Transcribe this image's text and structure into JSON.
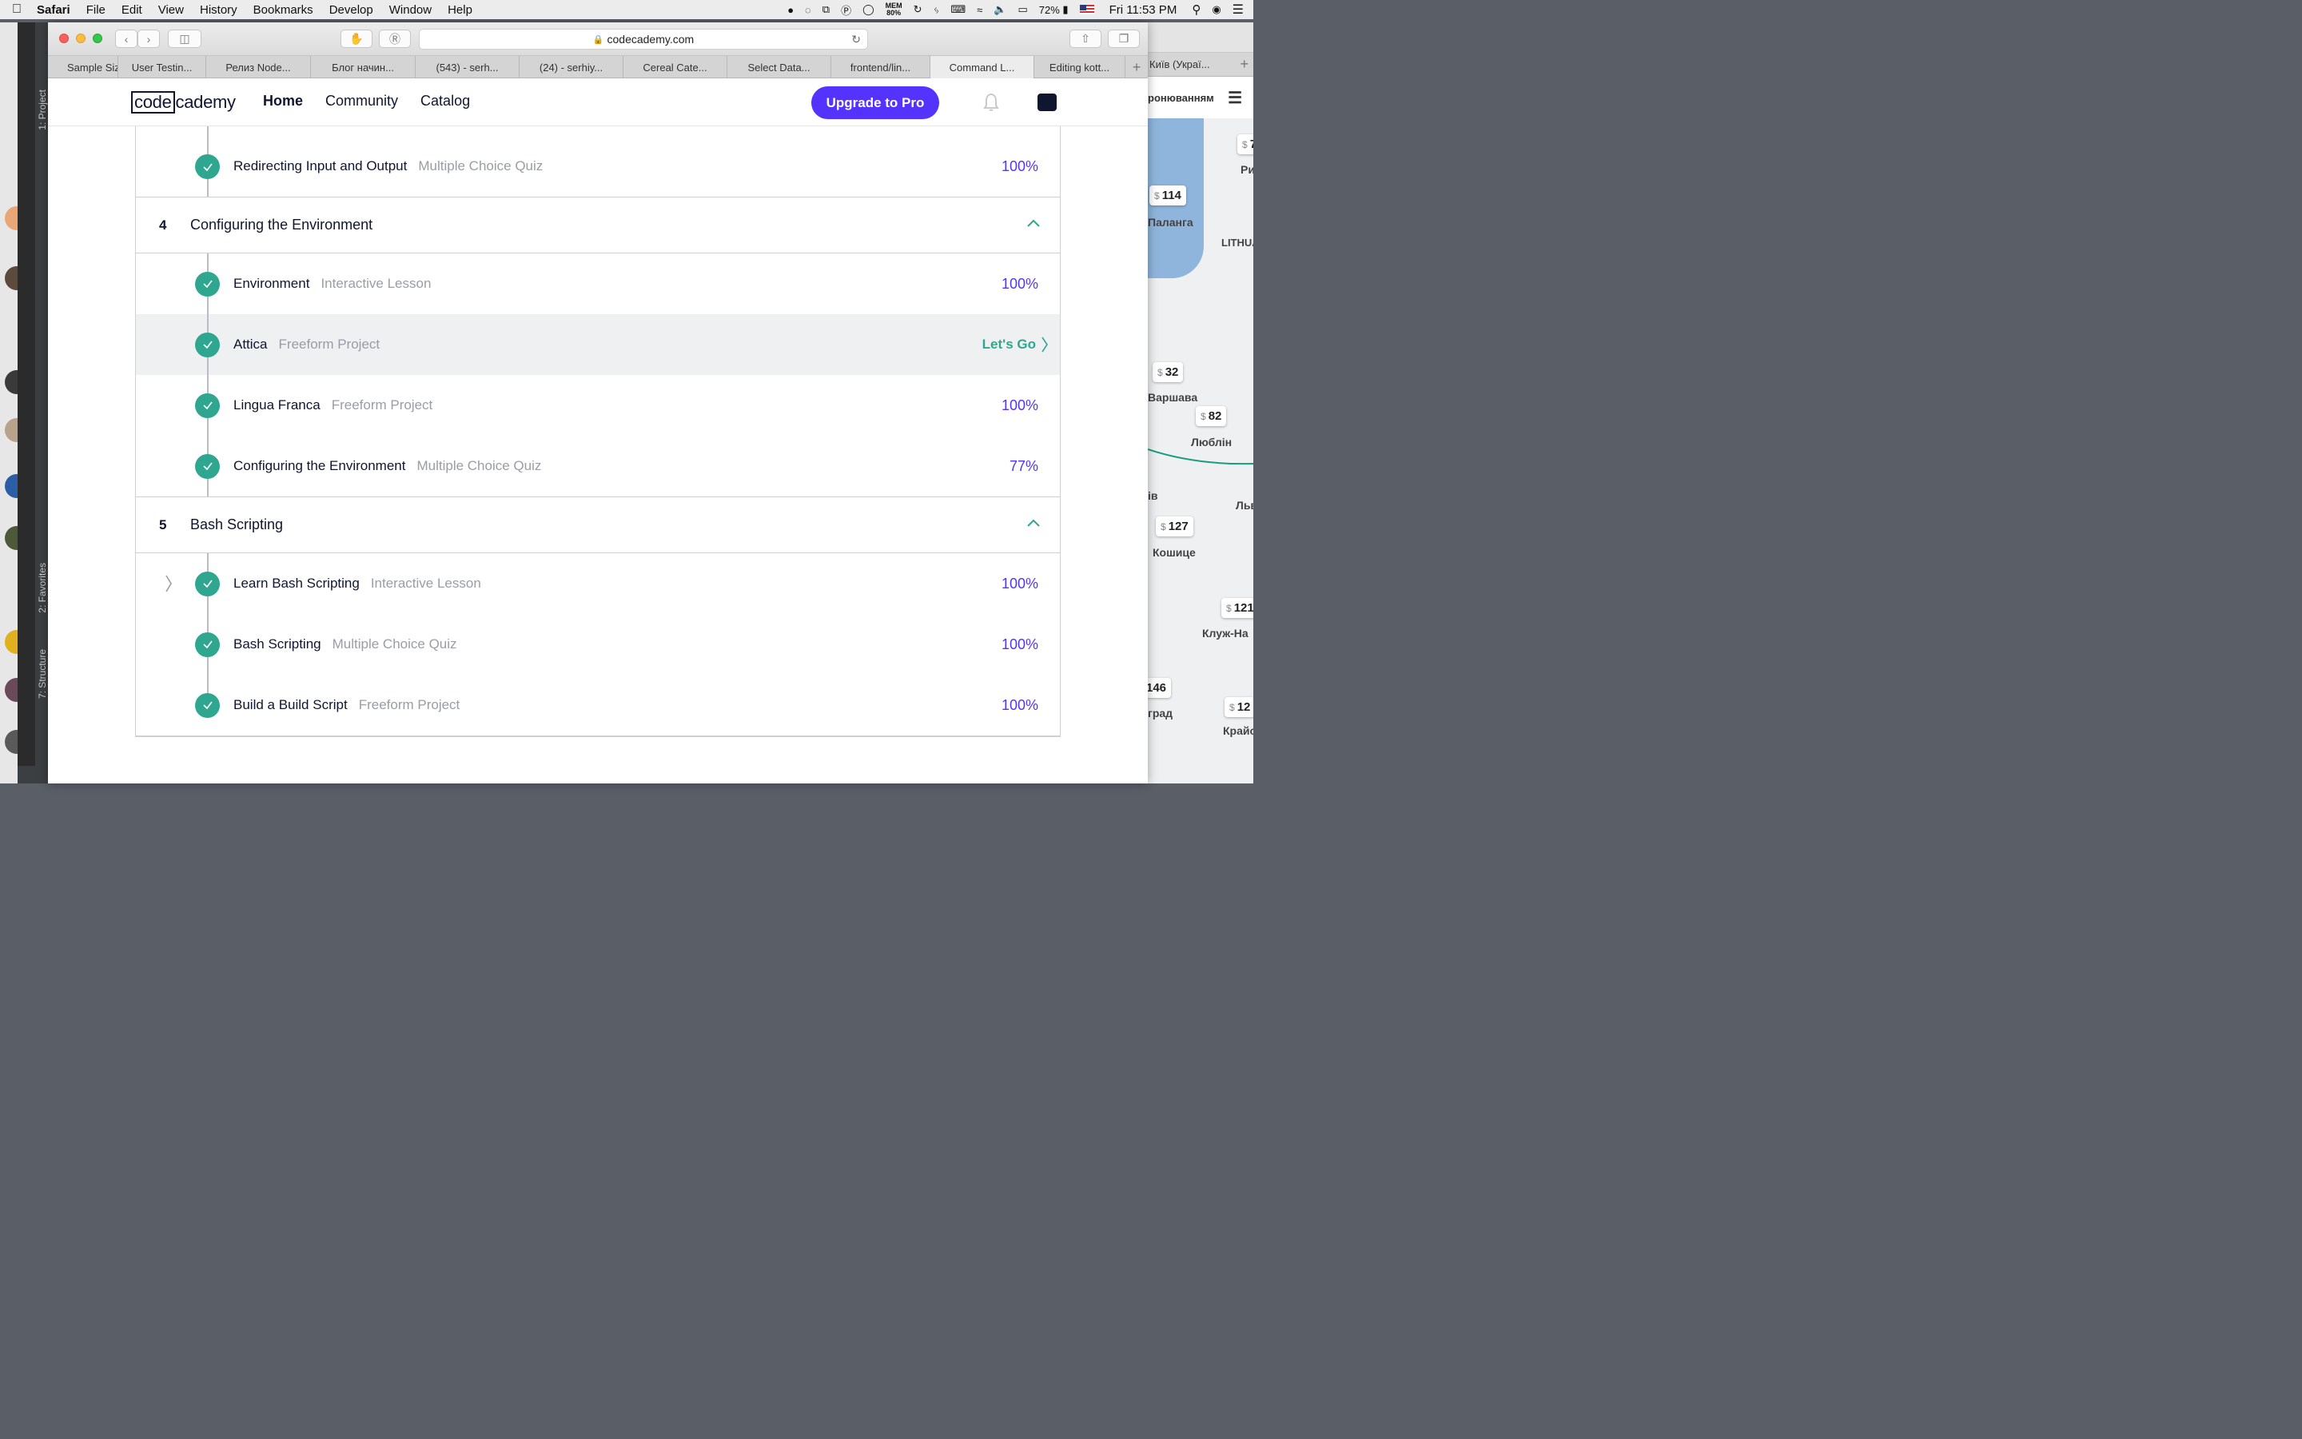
{
  "menubar": {
    "app": "Safari",
    "items": [
      "File",
      "Edit",
      "View",
      "History",
      "Bookmarks",
      "Develop",
      "Window",
      "Help"
    ],
    "mem_label": "MEM",
    "mem_value": "80%",
    "battery": "72%",
    "clock": "Fri 11:53 PM"
  },
  "browser": {
    "url": "codecademy.com",
    "tabs": [
      {
        "label": "Sample Size",
        "active": false
      },
      {
        "label": "User Testin...",
        "active": false
      },
      {
        "label": "Релиз Node...",
        "active": false
      },
      {
        "label": "Блог начин...",
        "active": false
      },
      {
        "label": "(543) - serh...",
        "active": false
      },
      {
        "label": "(24) - serhiy...",
        "active": false
      },
      {
        "label": "Cereal Cate...",
        "active": false
      },
      {
        "label": "Select Data...",
        "active": false
      },
      {
        "label": "frontend/lin...",
        "active": false
      },
      {
        "label": "Command L...",
        "active": true
      },
      {
        "label": "Editing kott...",
        "active": false
      }
    ],
    "new_tab": "+"
  },
  "codecademy": {
    "logo_boxed": "code",
    "logo_rest": "cademy",
    "nav": [
      "Home",
      "Community",
      "Catalog"
    ],
    "upgrade_button": "Upgrade to Pro"
  },
  "syllabus": {
    "lesson_top": {
      "title": "Redirecting Input and Output",
      "type": "Multiple Choice Quiz",
      "progress": "100%"
    },
    "section4": {
      "number": "4",
      "name": "Configuring the Environment",
      "items": [
        {
          "title": "Environment",
          "type": "Interactive Lesson",
          "progress": "100%"
        },
        {
          "title": "Attica",
          "type": "Freeform Project",
          "action": "Let's Go"
        },
        {
          "title": "Lingua Franca",
          "type": "Freeform Project",
          "progress": "100%"
        },
        {
          "title": "Configuring the Environment",
          "type": "Multiple Choice Quiz",
          "progress": "77%"
        }
      ]
    },
    "section5": {
      "number": "5",
      "name": "Bash Scripting",
      "items": [
        {
          "title": "Learn Bash Scripting",
          "type": "Interactive Lesson",
          "progress": "100%"
        },
        {
          "title": "Bash Scripting",
          "type": "Multiple Choice Quiz",
          "progress": "100%"
        },
        {
          "title": "Build a Build Script",
          "type": "Freeform Project",
          "progress": "100%"
        }
      ]
    }
  },
  "background_window": {
    "tab": "Київ (Украї...",
    "header": "ронюванням",
    "pins": [
      "114",
      "32",
      "82",
      "127",
      "121",
      "146",
      "12",
      "7"
    ],
    "cities": [
      "Паланга",
      "LITHUA",
      "Варшава",
      "Люблін",
      "Кошице",
      "Клуж-На",
      "град",
      "Крайо",
      "Льв",
      "Ри",
      "ів"
    ]
  },
  "ide": {
    "panels": [
      "1: Project",
      "2: Favorites",
      "7: Structure"
    ]
  },
  "colors": {
    "accent_purple": "#5533ff",
    "complete_green": "#2fa790",
    "text_navy": "#10162f"
  }
}
